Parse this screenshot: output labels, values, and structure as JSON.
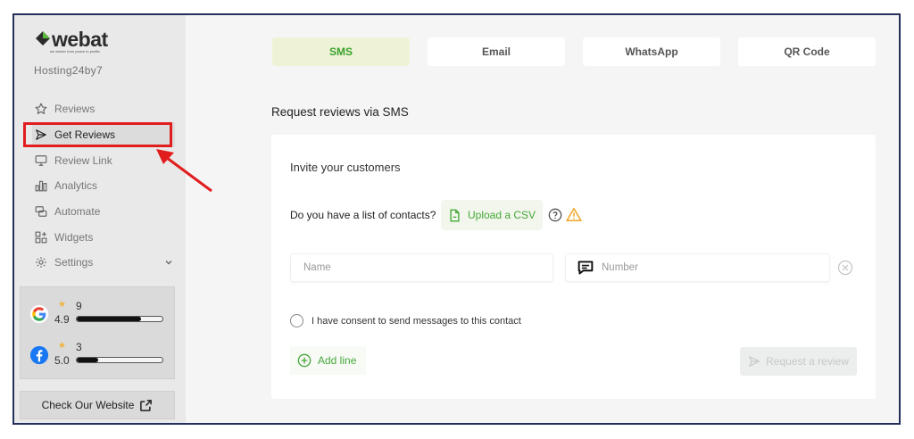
{
  "brand": {
    "logo_text": "webat",
    "tagline": "we deliver from peace to profits"
  },
  "company_name": "Hosting24by7",
  "sidebar": {
    "items": [
      {
        "label": "Reviews",
        "icon": "star-icon"
      },
      {
        "label": "Get Reviews",
        "icon": "send-icon",
        "active": true
      },
      {
        "label": "Review Link",
        "icon": "monitor-icon"
      },
      {
        "label": "Analytics",
        "icon": "bar-chart-icon"
      },
      {
        "label": "Automate",
        "icon": "automate-icon"
      },
      {
        "label": "Widgets",
        "icon": "widgets-icon"
      },
      {
        "label": "Settings",
        "icon": "gear-icon"
      }
    ],
    "ratings": [
      {
        "source": "google",
        "stars_icon": "star-icon",
        "count": "9",
        "average": "4.9",
        "bar_level": 0.75
      },
      {
        "source": "facebook",
        "stars_icon": "star-icon",
        "count": "3",
        "average": "5.0",
        "bar_level": 0.25
      }
    ],
    "check_website_label": "Check Our Website"
  },
  "tabs": [
    {
      "label": "SMS",
      "active": true
    },
    {
      "label": "Email"
    },
    {
      "label": "WhatsApp"
    },
    {
      "label": "QR Code"
    }
  ],
  "main": {
    "title": "Request reviews via SMS",
    "invite_title": "Invite your customers",
    "contacts_question": "Do you have a list of contacts?",
    "upload_label": "Upload a CSV",
    "name_placeholder": "Name",
    "number_placeholder": "Number",
    "consent_label": "I have consent to send messages to this contact",
    "add_line_label": "Add line",
    "request_label": "Request a review"
  },
  "colors": {
    "accent_green": "#45a83a",
    "active_tab_bg": "#eef3d8",
    "highlight_red": "#e11d1d",
    "frame_border": "#25305a"
  }
}
